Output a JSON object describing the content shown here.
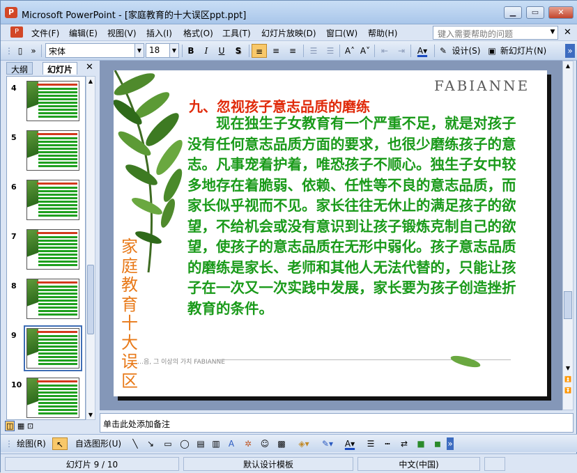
{
  "window": {
    "title": "Microsoft PowerPoint - [家庭教育的十大误区ppt.ppt]",
    "minimize": "▁",
    "maximize": "▭",
    "close": "✕"
  },
  "menu": {
    "items": [
      "文件(F)",
      "编辑(E)",
      "视图(V)",
      "插入(I)",
      "格式(O)",
      "工具(T)",
      "幻灯片放映(D)",
      "窗口(W)",
      "帮助(H)"
    ],
    "help_placeholder": "键入需要帮助的问题"
  },
  "toolbar": {
    "font_name": "宋体",
    "font_size": "18",
    "bold": "B",
    "italic": "I",
    "underline": "U",
    "shadow": "S",
    "design_label": "设计(S)",
    "new_slide_label": "新幻灯片(N)"
  },
  "panel": {
    "tab_outline": "大纲",
    "tab_slides": "幻灯片",
    "close": "✕",
    "thumbnails": [
      "4",
      "5",
      "6",
      "7",
      "8",
      "9",
      "10"
    ],
    "selected": "9"
  },
  "slide": {
    "brand": "FABIANNE",
    "heading": "九、忽视孩子意志品质的磨练",
    "body": "现在独生子女教育有一个严重不足，就是对孩子没有任何意志品质方面的要求，也很少磨练孩子的意志。凡事宠着护着，唯恐孩子不顺心。独生子女中较多地存在着脆弱、依赖、任性等不良的意志品质，而家长似乎视而不见。家长往往无休止的满足孩子的欲望，不给机会或没有意识到让孩子锻炼克制自己的欲望，使孩子的意志品质在无形中弱化。孩子意志品质的磨练是家长、老师和其他人无法代替的，只能让孩子在一次又一次实践中发展，家长要为孩子创造挫折教育的条件。",
    "side_title": "家庭教育十大误区",
    "footer": "…음, 그 이상의 가치 FABIANNE"
  },
  "notes": {
    "placeholder": "单击此处添加备注"
  },
  "drawbar": {
    "draw_label": "绘图(R)",
    "autoshape_label": "自选图形(U)"
  },
  "status": {
    "slide_counter": "幻灯片 9 / 10",
    "template": "默认设计模板",
    "language": "中文(中国)"
  }
}
